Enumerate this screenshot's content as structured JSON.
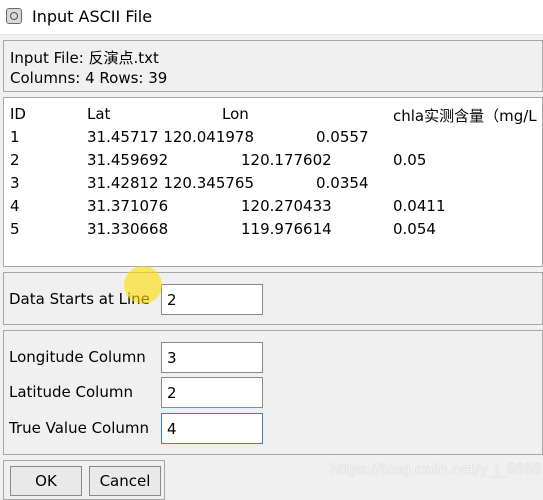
{
  "window": {
    "title": "Input ASCII File"
  },
  "info": {
    "input_file": "Input File: 反演点.txt",
    "columns_rows": "Columns: 4  Rows: 39"
  },
  "preview": {
    "headers": [
      "ID",
      "Lat",
      "Lon",
      "chla实测含量（mg/L"
    ],
    "rows": [
      [
        "1",
        "31.45717 120.041978",
        "0.0557"
      ],
      [
        "2",
        "31.459692",
        "120.177602",
        "0.05"
      ],
      [
        "3",
        "31.42812 120.345765",
        "0.0354"
      ],
      [
        "4",
        "31.371076",
        "120.270433",
        "0.0411"
      ],
      [
        "5",
        "31.330668",
        "119.976614",
        "0.054"
      ]
    ]
  },
  "data_starts": {
    "label": "Data Starts at Line",
    "value": "2"
  },
  "columns": {
    "longitude": {
      "label": "Longitude Column",
      "value": "3"
    },
    "latitude": {
      "label": "Latitude Column",
      "value": "2"
    },
    "true_value": {
      "label": "True Value Column",
      "value": "4"
    }
  },
  "buttons": {
    "ok": "OK",
    "cancel": "Cancel"
  },
  "watermark": "https://blog.csdn.net/y_j_6666"
}
